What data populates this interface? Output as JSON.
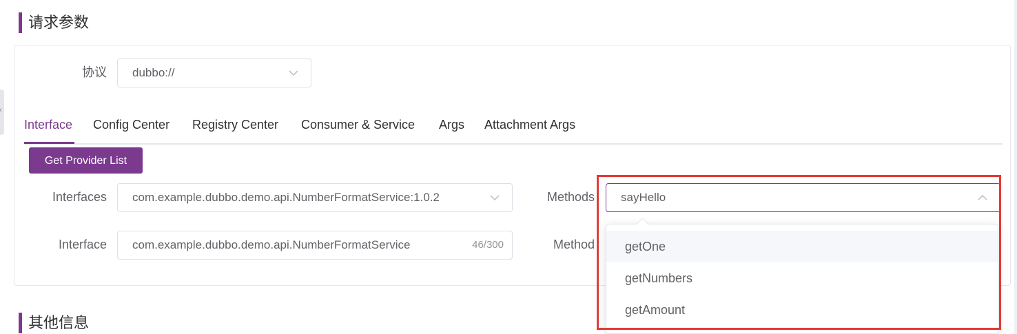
{
  "sections": {
    "request_params": "请求参数",
    "other_info": "其他信息"
  },
  "protocol": {
    "label": "协议",
    "value": "dubbo://"
  },
  "tabs": [
    {
      "label": "Interface",
      "active": true
    },
    {
      "label": "Config Center",
      "active": false
    },
    {
      "label": "Registry Center",
      "active": false
    },
    {
      "label": "Consumer & Service",
      "active": false
    },
    {
      "label": "Args",
      "active": false
    },
    {
      "label": "Attachment Args",
      "active": false
    }
  ],
  "buttons": {
    "get_provider_list": "Get Provider List"
  },
  "interfaces": {
    "label": "Interfaces",
    "value": "com.example.dubbo.demo.api.NumberFormatService:1.0.2"
  },
  "interface": {
    "label": "Interface",
    "value": "com.example.dubbo.demo.api.NumberFormatService",
    "counter": "46/300"
  },
  "methods": {
    "label": "Methods",
    "value": "sayHello",
    "options": [
      "getOne",
      "getNumbers",
      "getAmount"
    ]
  },
  "method": {
    "label": "Method"
  },
  "colors": {
    "accent": "#7b3a8e",
    "highlight_frame": "#e53935"
  },
  "icons": {
    "select_closed": "chevron-down-icon",
    "select_open": "chevron-up-icon"
  }
}
